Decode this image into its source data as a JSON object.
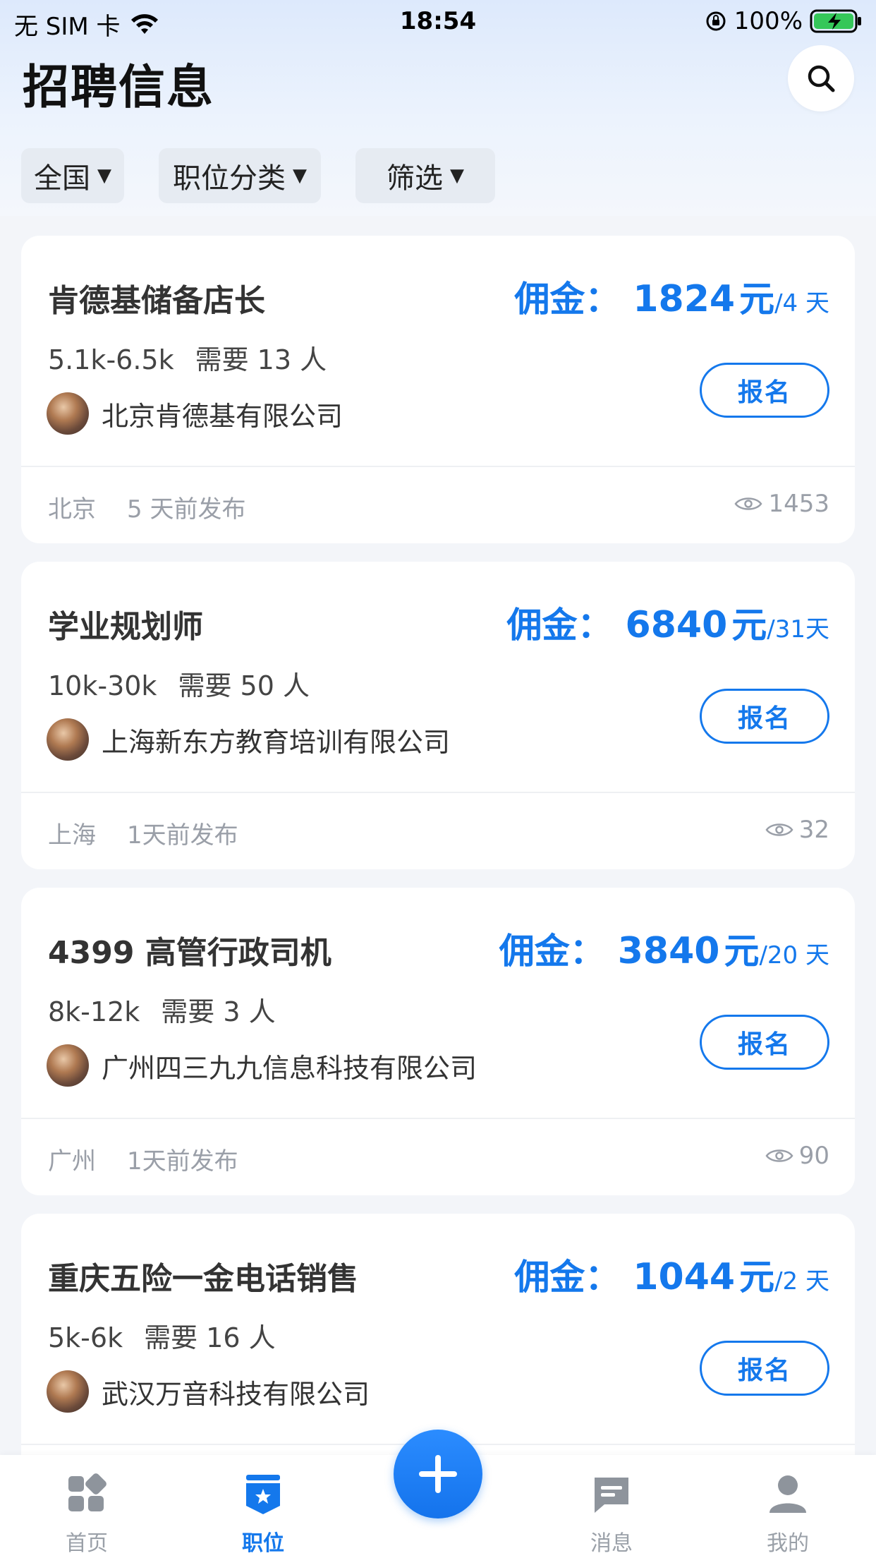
{
  "status_bar": {
    "carrier": "无 SIM 卡",
    "time": "18:54",
    "battery": "100%"
  },
  "header": {
    "title": "招聘信息",
    "search_icon": "search-icon"
  },
  "filters": [
    {
      "label": "全国"
    },
    {
      "label": "职位分类"
    },
    {
      "label": "筛选"
    }
  ],
  "filter_arrow": "▼",
  "commission_label": "佣金：",
  "currency_unit": "元",
  "apply_label": "报名",
  "jobs": [
    {
      "title": "肯德基储备店长",
      "commission": "1824",
      "period": "/4 天",
      "salary": "5.1k-6.5k",
      "need": "需要 13 人",
      "company": "北京肯德基有限公司",
      "city": "北京",
      "posted": "5 天前发布",
      "views": "1453"
    },
    {
      "title": "学业规划师",
      "commission": "6840",
      "period": "/31天",
      "salary": "10k-30k",
      "need": "需要 50 人",
      "company": "上海新东方教育培训有限公司",
      "city": "上海",
      "posted": "1天前发布",
      "views": "32"
    },
    {
      "title": "4399 高管行政司机",
      "commission": "3840",
      "period": "/20 天",
      "salary": "8k-12k",
      "need": "需要 3 人",
      "company": "广州四三九九信息科技有限公司",
      "city": "广州",
      "posted": "1天前发布",
      "views": "90"
    },
    {
      "title": "重庆五险一金电话销售",
      "commission": "1044",
      "period": "/2 天",
      "salary": "5k-6k",
      "need": "需要 16 人",
      "company": "武汉万音科技有限公司"
    }
  ],
  "tab_bar": {
    "items": [
      {
        "label": "首页",
        "icon": "home-grid-icon"
      },
      {
        "label": "职位",
        "icon": "job-badge-icon",
        "active": true
      },
      {
        "label": "消息",
        "icon": "message-icon"
      },
      {
        "label": "我的",
        "icon": "profile-icon"
      }
    ],
    "fab_icon": "plus-icon"
  },
  "colors": {
    "accent": "#1478ec",
    "muted": "#9a9fa8",
    "background": "#f3f5f9"
  }
}
